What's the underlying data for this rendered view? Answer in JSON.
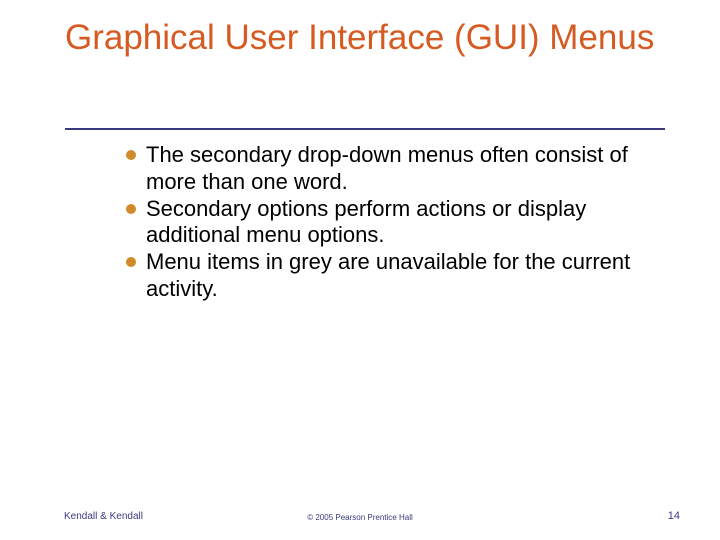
{
  "title": "Graphical User Interface (GUI) Menus",
  "bullets": [
    "The secondary drop-down menus often consist of more than one word.",
    "Secondary options perform actions or display additional menu options.",
    "Menu items in grey are unavailable for the current activity."
  ],
  "footer": {
    "left": "Kendall & Kendall",
    "center": "© 2005 Pearson Prentice Hall",
    "right": "14"
  },
  "colors": {
    "title": "#d55b23",
    "divider": "#3a3a7d",
    "bullet_dot": "#cf8a2a",
    "footer": "#3a3a7d"
  }
}
